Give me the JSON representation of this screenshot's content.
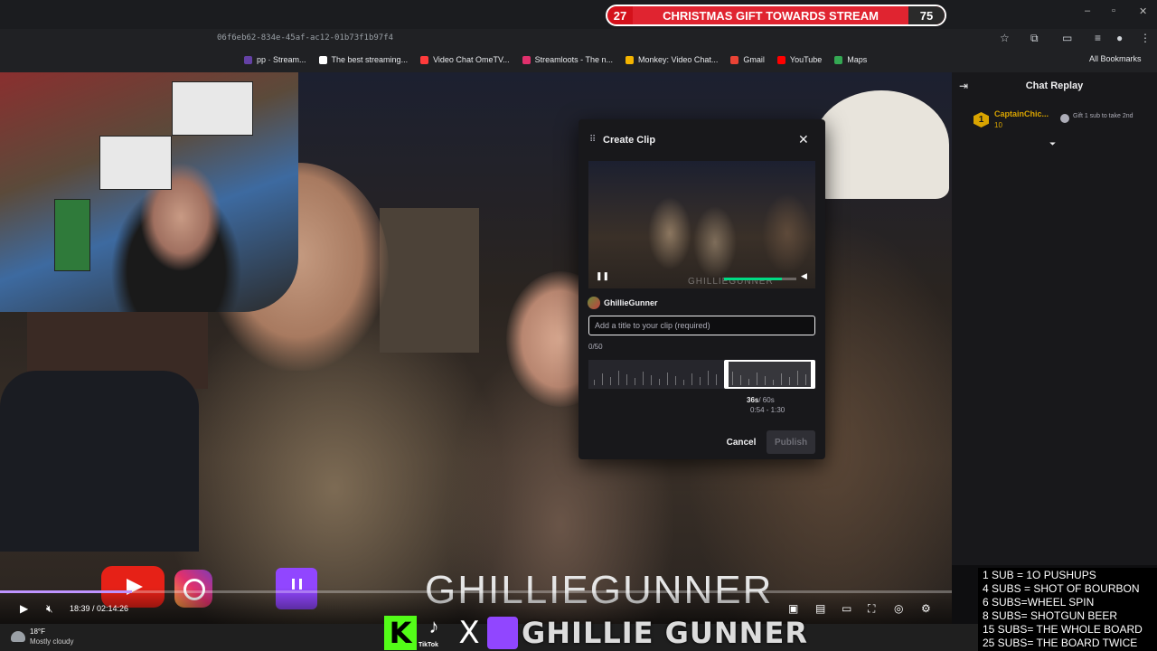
{
  "browser": {
    "url": "06f6eb62-834e-45af-ac12-01b73f1b97f4",
    "bookmarks": [
      {
        "label": "pp · Stream...",
        "color": "#6441a5"
      },
      {
        "label": "The best streaming...",
        "color": "#ffffff"
      },
      {
        "label": "Video Chat OmeTV...",
        "color": "#ff3b3b"
      },
      {
        "label": "Streamloots - The n...",
        "color": "#e0306c"
      },
      {
        "label": "Monkey: Video Chat...",
        "color": "#f4b400"
      },
      {
        "label": "Gmail",
        "color": "#ea4335"
      },
      {
        "label": "YouTube",
        "color": "#ff0000"
      },
      {
        "label": "Maps",
        "color": "#34a853"
      }
    ],
    "all_bookmarks": "All Bookmarks"
  },
  "goal": {
    "current": "27",
    "label": "CHRISTMAS GIFT TOWARDS STREAM",
    "target": "75"
  },
  "player": {
    "timecode": "18:39 / 02:14:26",
    "progress_fraction": 0.139,
    "overlay_name": "GHILLIEGUNNER"
  },
  "clip": {
    "title": "Create Clip",
    "author": "GhillieGunner",
    "input_placeholder": "Add a title to your clip (required)",
    "input_value": "",
    "char_count": "0/50",
    "duration": "36s",
    "max_duration": "/ 60s",
    "range": "0:54 - 1:30",
    "cancel_label": "Cancel",
    "publish_label": "Publish",
    "preview_watermark": "GHILLIEGUNNER",
    "volume_fraction": 0.8
  },
  "chat": {
    "title": "Chat Replay",
    "messages": [
      {
        "user": "CaptainChic...",
        "badge": "1",
        "count": "10",
        "text": "Gift 1 sub to take 2nd"
      }
    ]
  },
  "rules": [
    "1 SUB = 1O PUSHUPS",
    "4 SUBS = SHOT OF BOURBON",
    "6 SUBS=WHEEL SPIN",
    "8 SUBS= SHOTGUN BEER",
    "15 SUBS= THE WHOLE BOARD",
    "25 SUBS= THE  BOARD TWICE"
  ],
  "taskbar": {
    "temp": "18°F",
    "weather": "Mostly cloudy"
  },
  "social": {
    "tiktok_label": "TikTok",
    "name": "GHILLIE GUNNER"
  },
  "colors": {
    "accent": "#9146ff",
    "goal_red": "#d4111b",
    "kick_green": "#53fc18",
    "gold": "#d9a400"
  }
}
